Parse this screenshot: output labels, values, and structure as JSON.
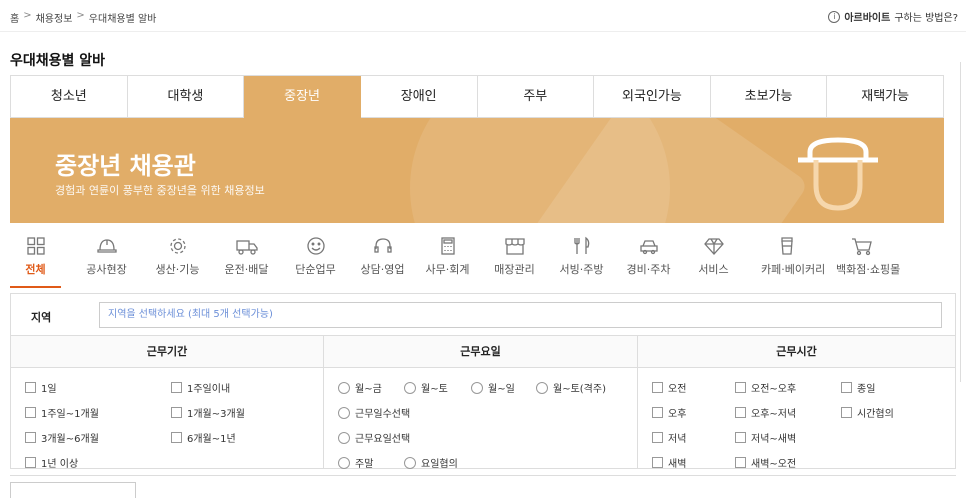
{
  "breadcrumb": {
    "home": "홈",
    "section": "채용정보",
    "current": "우대채용별 알바",
    "separator": ">"
  },
  "help": {
    "bold": "아르바이트",
    "rest": "구하는 방법은?"
  },
  "page_title": "우대채용별 알바",
  "tabs": [
    {
      "label": "청소년"
    },
    {
      "label": "대학생"
    },
    {
      "label": "중장년"
    },
    {
      "label": "장애인"
    },
    {
      "label": "주부"
    },
    {
      "label": "외국인가능"
    },
    {
      "label": "초보가능"
    },
    {
      "label": "재택가능"
    }
  ],
  "active_tab": "중장년",
  "banner": {
    "title": "중장년 채용관",
    "subtitle": "경험과 연륜이 풍부한 중장년을 위한 채용정보",
    "color": "#e1ad68"
  },
  "categories": [
    {
      "label": "전체",
      "icon": "grid-icon"
    },
    {
      "label": "공사현장",
      "icon": "helmet-icon"
    },
    {
      "label": "생산·기능",
      "icon": "gear-icon"
    },
    {
      "label": "운전·배달",
      "icon": "truck-icon"
    },
    {
      "label": "단순업무",
      "icon": "smile-icon"
    },
    {
      "label": "상담·영업",
      "icon": "headset-icon"
    },
    {
      "label": "사무·회계",
      "icon": "calculator-icon"
    },
    {
      "label": "매장관리",
      "icon": "store-icon"
    },
    {
      "label": "서빙·주방",
      "icon": "fork-knife-icon"
    },
    {
      "label": "경비·주차",
      "icon": "car-icon"
    },
    {
      "label": "서비스",
      "icon": "diamond-icon"
    },
    {
      "label": "카페·베이커리",
      "icon": "cup-icon"
    },
    {
      "label": "백화점·쇼핑몰",
      "icon": "cart-icon"
    }
  ],
  "accent_color": "#e05a18",
  "region": {
    "label": "지역",
    "placeholder": "지역을 선택하세요 (최대 5개 선택가능)"
  },
  "conditions": {
    "period": {
      "header": "근무기간",
      "options": [
        "1일",
        "1주일이내",
        "1주일~1개월",
        "1개월~3개월",
        "3개월~6개월",
        "6개월~1년",
        "1년 이상"
      ]
    },
    "days": {
      "header": "근무요일",
      "options": [
        "월~금",
        "월~토",
        "월~일",
        "월~토(격주)",
        "근무일수선택",
        "근무요일선택",
        "주말",
        "요일협의"
      ]
    },
    "time": {
      "header": "근무시간",
      "options": [
        "오전",
        "오전~오후",
        "종일",
        "오후",
        "오후~저녁",
        "시간협의",
        "저녁",
        "저녁~새벽",
        "새벽",
        "새벽~오전"
      ]
    }
  }
}
